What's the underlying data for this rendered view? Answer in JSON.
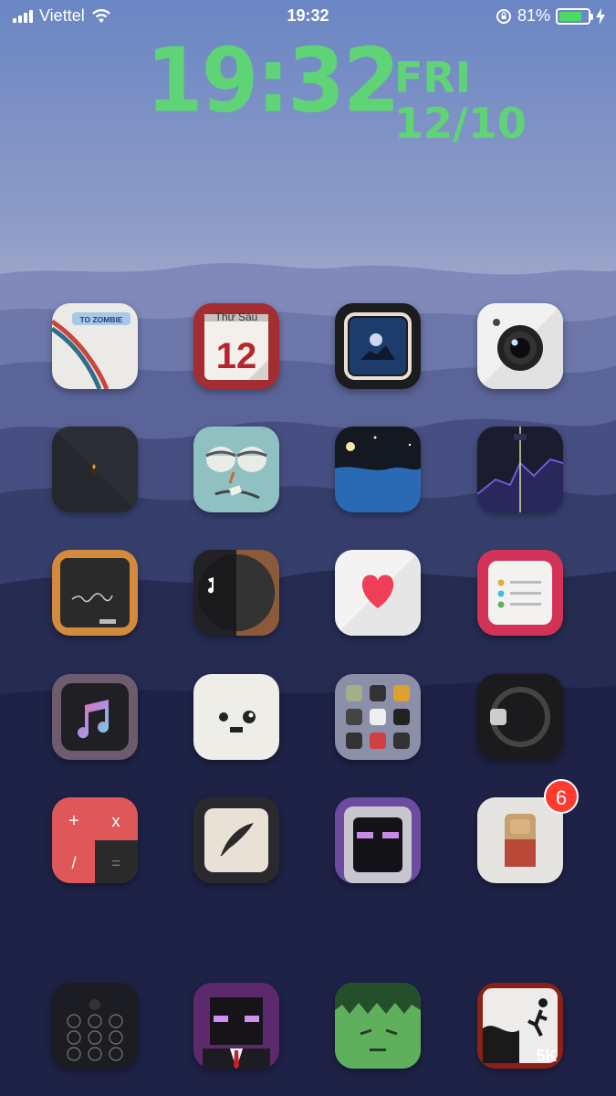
{
  "status_bar": {
    "carrier": "Viettel",
    "time": "19:32",
    "battery_percent": "81%",
    "battery_level": 0.81
  },
  "clock_widget": {
    "time": "19:32",
    "day": "FRI",
    "date": "12/10",
    "color": "#5fd477"
  },
  "apps": {
    "zombie": {
      "label": "TO ZOMBIE"
    },
    "calendar": {
      "weekday": "Thứ Sáu",
      "day": "12"
    },
    "plague": {
      "badge": "6"
    },
    "run": {
      "label": "5K"
    }
  }
}
